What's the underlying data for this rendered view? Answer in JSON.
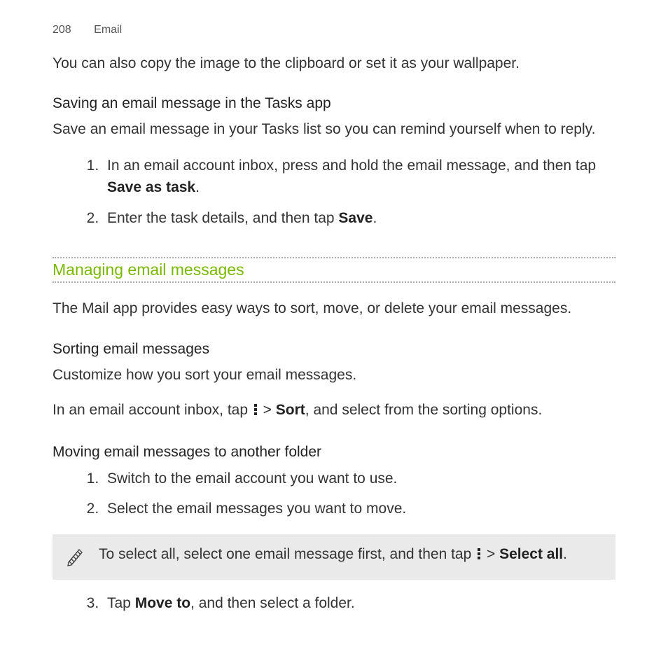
{
  "header": {
    "page_number": "208",
    "section": "Email"
  },
  "intro_line": "You can also copy the image to the clipboard or set it as your wallpaper.",
  "tasks": {
    "heading": "Saving an email message in the Tasks app",
    "desc": "Save an email message in your Tasks list so you can remind yourself when to reply.",
    "step1_a": "In an email account inbox, press and hold the email message, and then tap ",
    "step1_b_bold": "Save as task",
    "step1_c": ".",
    "step2_a": "Enter the task details, and then tap ",
    "step2_b_bold": "Save",
    "step2_c": "."
  },
  "manage": {
    "heading": "Managing email messages",
    "desc": "The Mail app provides easy ways to sort, move, or delete your email messages."
  },
  "sort": {
    "heading": "Sorting email messages",
    "desc": "Customize how you sort your email messages.",
    "line_a": "In an email account inbox, tap ",
    "line_b": " > ",
    "line_c_bold": "Sort",
    "line_d": ", and select from the sorting options."
  },
  "move": {
    "heading": "Moving email messages to another folder",
    "step1": "Switch to the email account you want to use.",
    "step2": "Select the email messages you want to move.",
    "step3_a": "Tap ",
    "step3_b_bold": "Move to",
    "step3_c": ", and then select a folder.",
    "note_a": "To select all, select one email message first, and then tap ",
    "note_b": " > ",
    "note_c_bold": "Select all",
    "note_d": "."
  }
}
